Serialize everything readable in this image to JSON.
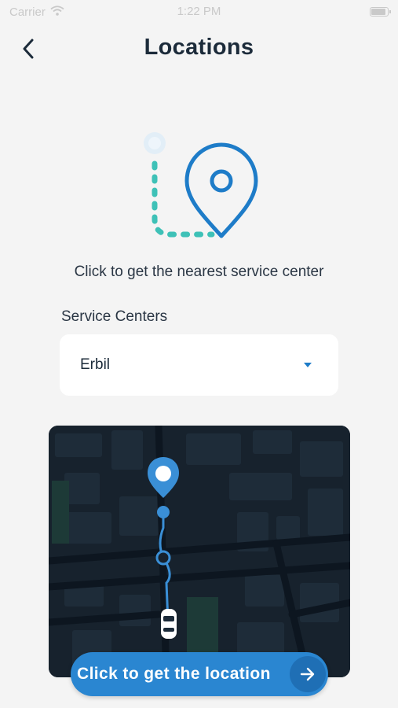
{
  "status_bar": {
    "carrier": "Carrier",
    "time": "1:22 PM"
  },
  "header": {
    "title": "Locations"
  },
  "hint": "Click to get the nearest service center",
  "service_centers": {
    "label": "Service Centers",
    "selected": "Erbil"
  },
  "cta": {
    "label": "Click to get the location"
  },
  "icons": {
    "back": "chevron-left-icon",
    "wifi": "wifi-icon",
    "battery": "battery-icon",
    "pin": "location-pin-icon",
    "caret": "caret-down-icon",
    "car": "car-icon",
    "arrow": "arrow-right-icon"
  },
  "colors": {
    "accent": "#1e7cc8",
    "route_dots": "#3ec1b7",
    "map_bg": "#17222d",
    "button": "#2a86d1"
  }
}
